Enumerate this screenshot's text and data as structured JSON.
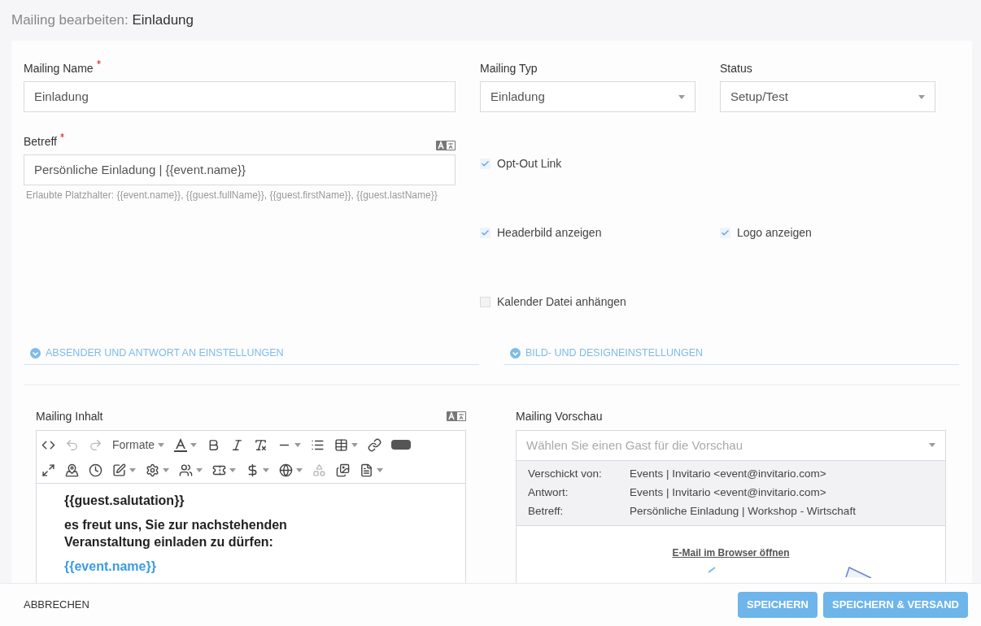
{
  "header": {
    "prefix": "Mailing bearbeiten:",
    "title": "Einladung"
  },
  "mailing_name": {
    "label": "Mailing Name",
    "required": true,
    "value": "Einladung"
  },
  "subject": {
    "label": "Betreff",
    "required": true,
    "value": "Persönliche Einladung | {{event.name}}",
    "hint": "Erlaubte Platzhalter: {{event.name}}, {{guest.fullName}}, {{guest.firstName}}, {{guest.lastName}}"
  },
  "mailing_type": {
    "label": "Mailing Typ",
    "value": "Einladung"
  },
  "status": {
    "label": "Status",
    "value": "Setup/Test"
  },
  "checkbox_rows": [
    [
      {
        "label": "Opt-Out Link",
        "checked": true
      }
    ],
    [
      {
        "label": "Headerbild anzeigen",
        "checked": true
      },
      {
        "label": "Logo anzeigen",
        "checked": true
      }
    ],
    [
      {
        "label": "Kalender Datei anhängen",
        "checked": false
      }
    ]
  ],
  "sections": [
    {
      "label": "ABSENDER UND ANTWORT AN EINSTELLUNGEN",
      "expanded": false
    },
    {
      "label": "BILD- UND DESIGNEINSTELLUNGEN",
      "expanded": false
    }
  ],
  "editor": {
    "label": "Mailing Inhalt",
    "format_label": "Formate",
    "content": [
      {
        "kind": "text",
        "text": "{{guest.salutation}}"
      },
      {
        "kind": "text",
        "text": "es freut uns, Sie zur nachstehenden Veranstaltung einladen zu dürfen:"
      },
      {
        "kind": "placeholder",
        "text": "{{event.name}}"
      }
    ]
  },
  "preview": {
    "label": "Mailing Vorschau",
    "placeholder": "Wählen Sie einen Gast für die Vorschau",
    "meta": [
      {
        "label": "Verschickt von:",
        "value": "Events | Invitario <event@invitario.com>"
      },
      {
        "label": "Antwort:",
        "value": "Events | Invitario <event@invitario.com>"
      },
      {
        "label": "Betreff:",
        "value": "Persönliche Einladung | Workshop - Wirtschaft"
      }
    ],
    "browser_link": "E-Mail im Browser öffnen"
  },
  "footer": {
    "cancel": "ABBRECHEN",
    "buttons": [
      "SPEICHERN",
      "SPEICHERN & VERSAND"
    ]
  }
}
